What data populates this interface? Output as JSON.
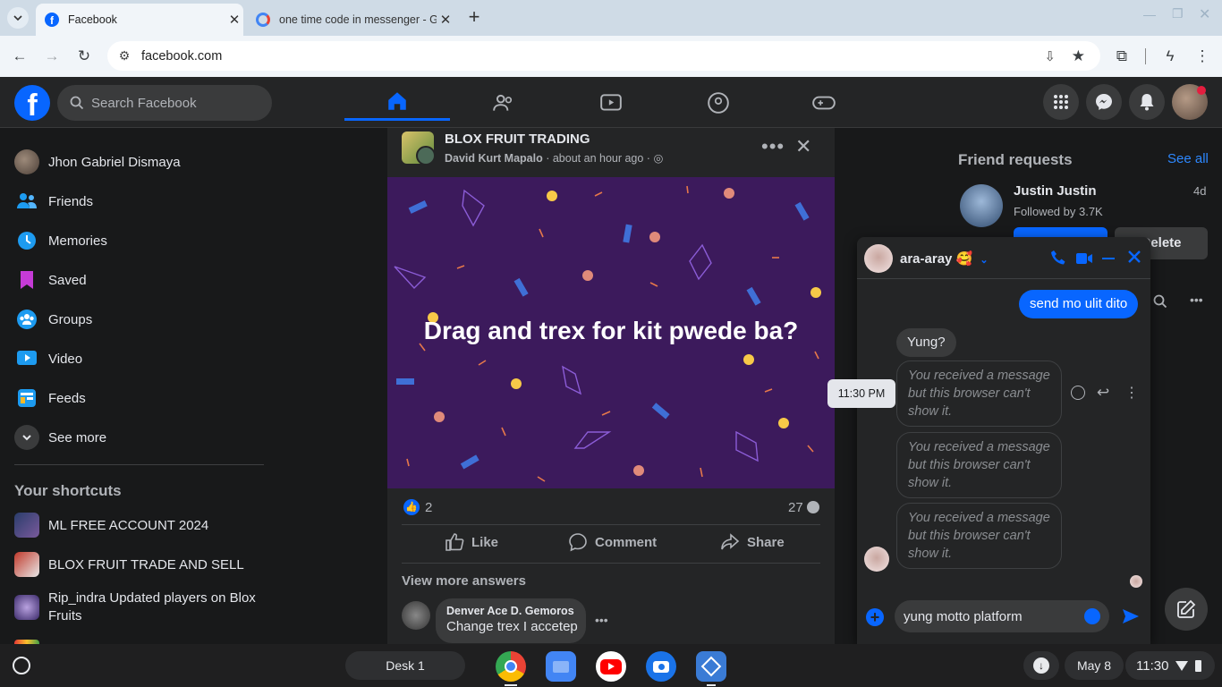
{
  "browser": {
    "tabs": [
      {
        "title": "Facebook",
        "active": true
      },
      {
        "title": "one time code in messenger - G",
        "active": false
      }
    ],
    "url": "facebook.com"
  },
  "fb": {
    "search_placeholder": "Search Facebook",
    "brand_color": "#0866ff",
    "sidebar": {
      "items": [
        {
          "label": "Jhon Gabriel Dismaya",
          "icon": "avatar"
        },
        {
          "label": "Friends",
          "icon": "friends-icon"
        },
        {
          "label": "Memories",
          "icon": "memories-icon"
        },
        {
          "label": "Saved",
          "icon": "saved-icon"
        },
        {
          "label": "Groups",
          "icon": "groups-icon"
        },
        {
          "label": "Video",
          "icon": "video-icon"
        },
        {
          "label": "Feeds",
          "icon": "feeds-icon"
        },
        {
          "label": "See more",
          "icon": "chevron-down-icon"
        }
      ],
      "shortcuts_title": "Your shortcuts",
      "shortcuts": [
        {
          "label": "ML FREE ACCOUNT 2024"
        },
        {
          "label": "BLOX FRUIT TRADE AND SELL"
        },
        {
          "label": "Rip_indra Updated players on Blox Fruits"
        }
      ]
    },
    "post": {
      "group": "BLOX FRUIT TRADING",
      "author": "David Kurt Mapalo",
      "time": " · about an hour ago · ",
      "text": "Drag and trex for kit pwede ba?",
      "bg_color": "#3c1a5c",
      "reactions": "2",
      "comments_count": "27",
      "like": "Like",
      "comment": "Comment",
      "share": "Share",
      "view_more": "View more answers",
      "comment_author": "Denver Ace D. Gemoros",
      "comment_text": "Change trex I accetep"
    },
    "right": {
      "friend_requests": "Friend requests",
      "see_all": "See all",
      "req_name": "Justin Justin",
      "req_sub": "Followed by 3.7K",
      "req_time": "4d",
      "delete": "Delete"
    },
    "chat": {
      "name": "ara-aray 🥰",
      "sent": "send mo ulit dito",
      "received": "Yung?",
      "hidden_msg": "You received a message but this browser can't show it.",
      "time_tooltip": "11:30 PM",
      "input_value": "yung motto platform"
    }
  },
  "os": {
    "desk": "Desk 1",
    "date": "May 8",
    "time": "11:30"
  }
}
